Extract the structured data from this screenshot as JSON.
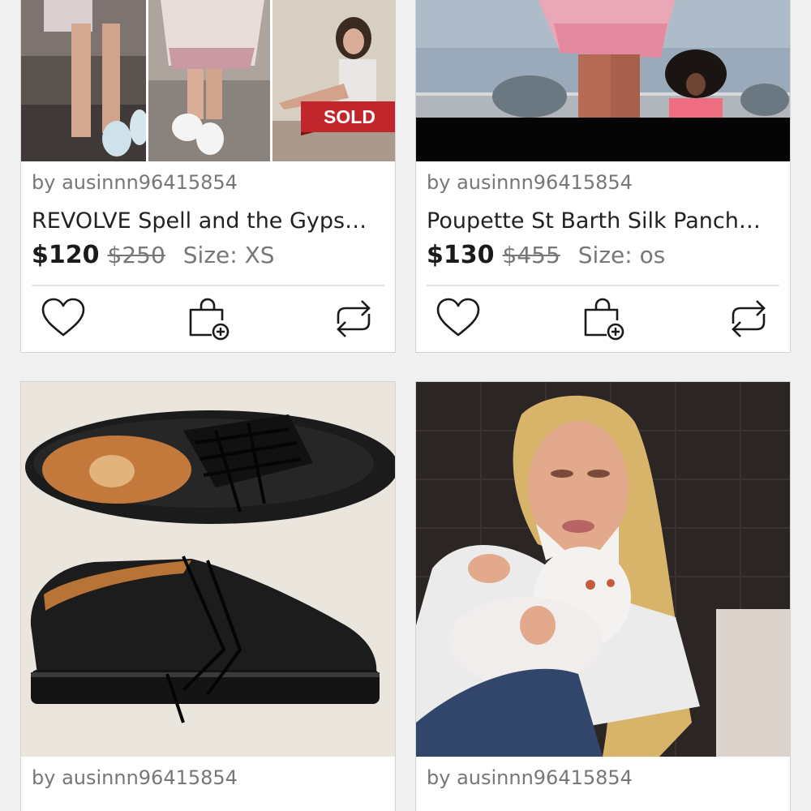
{
  "listings": [
    {
      "seller": "by ausinnn96415854",
      "title": "REVOLVE Spell and the Gyps…",
      "price": "$120",
      "original_price": "$250",
      "size": "Size: XS",
      "badge": "SOLD"
    },
    {
      "seller": "by ausinnn96415854",
      "title": "Poupette St Barth Silk Panch…",
      "price": "$130",
      "original_price": "$455",
      "size": "Size: os"
    },
    {
      "seller": "by ausinnn96415854"
    },
    {
      "seller": "by ausinnn96415854"
    }
  ],
  "icons": {
    "like": "heart-icon",
    "bundle": "shopping-bag-plus-icon",
    "share": "repost-icon"
  },
  "colors": {
    "sold_badge": "#c0262c",
    "text_primary": "#222222",
    "text_secondary": "#777777"
  }
}
